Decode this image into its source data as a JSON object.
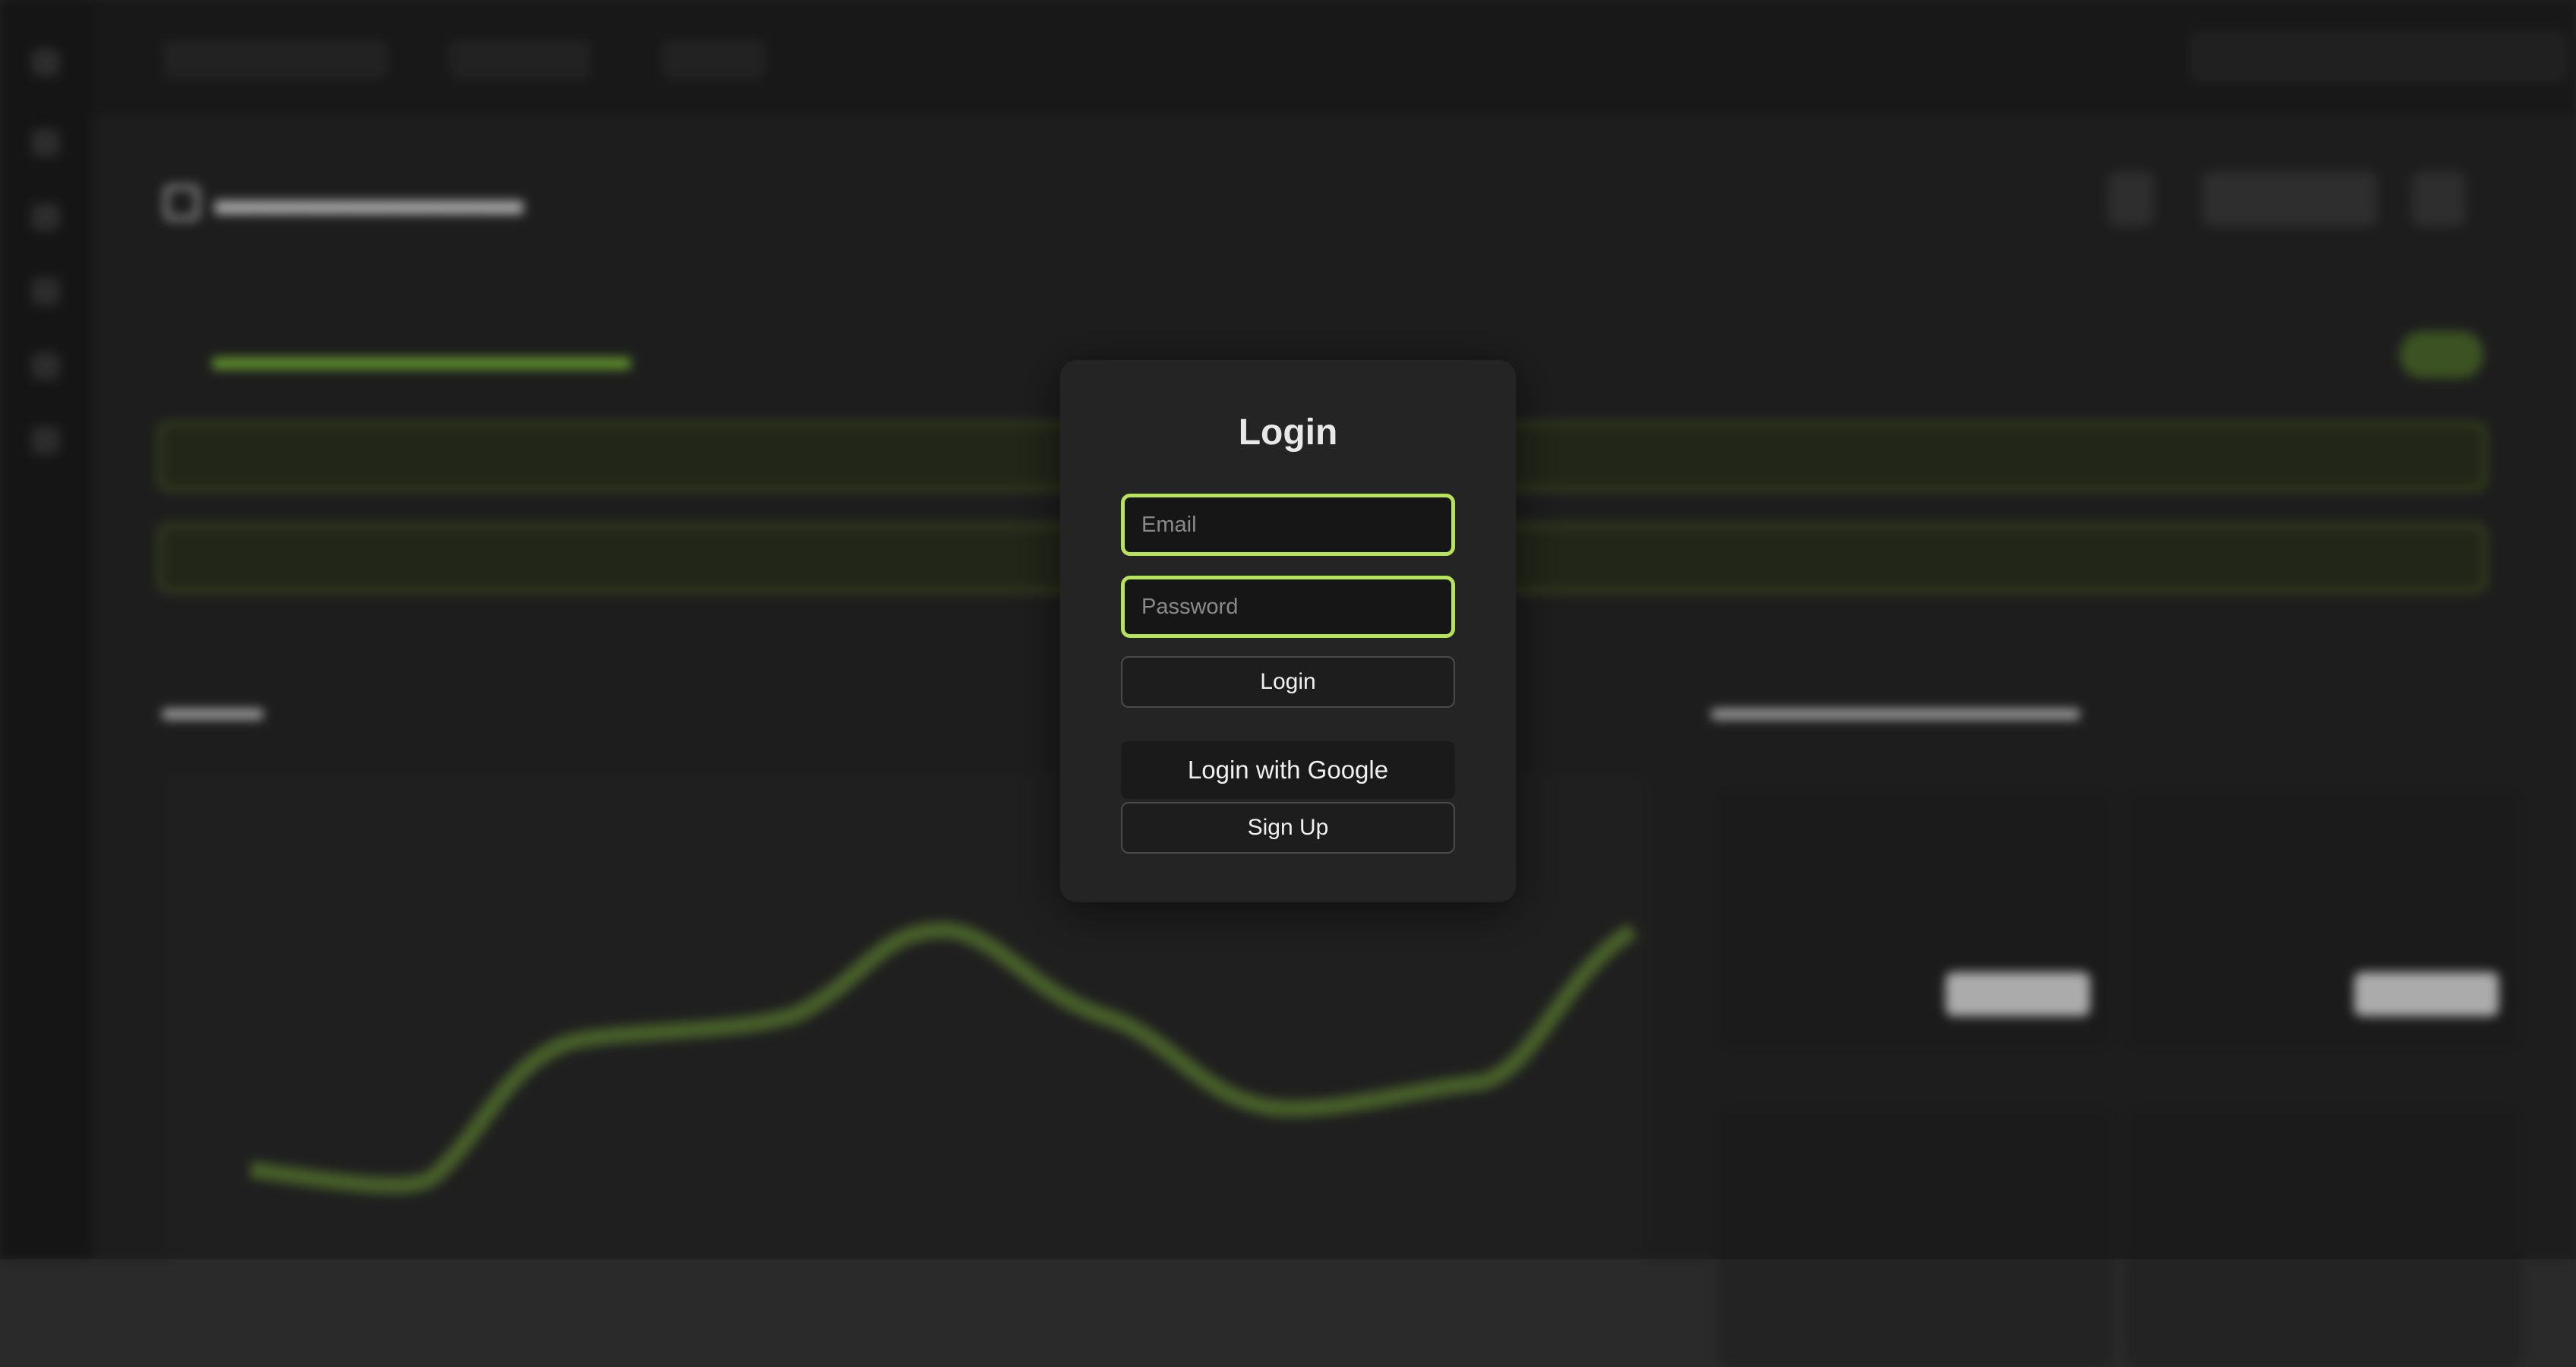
{
  "login_modal": {
    "title": "Login",
    "email_placeholder": "Email",
    "password_placeholder": "Password",
    "login_label": "Login",
    "google_label": "Login with Google",
    "signup_label": "Sign Up"
  },
  "colors": {
    "accent": "#b7e35a",
    "modal_bg": "#242424",
    "page_bg": "#2a2a2a",
    "input_bg": "#161616"
  },
  "background": {
    "blurred": true,
    "chart_line_color": "#5c7a35"
  }
}
